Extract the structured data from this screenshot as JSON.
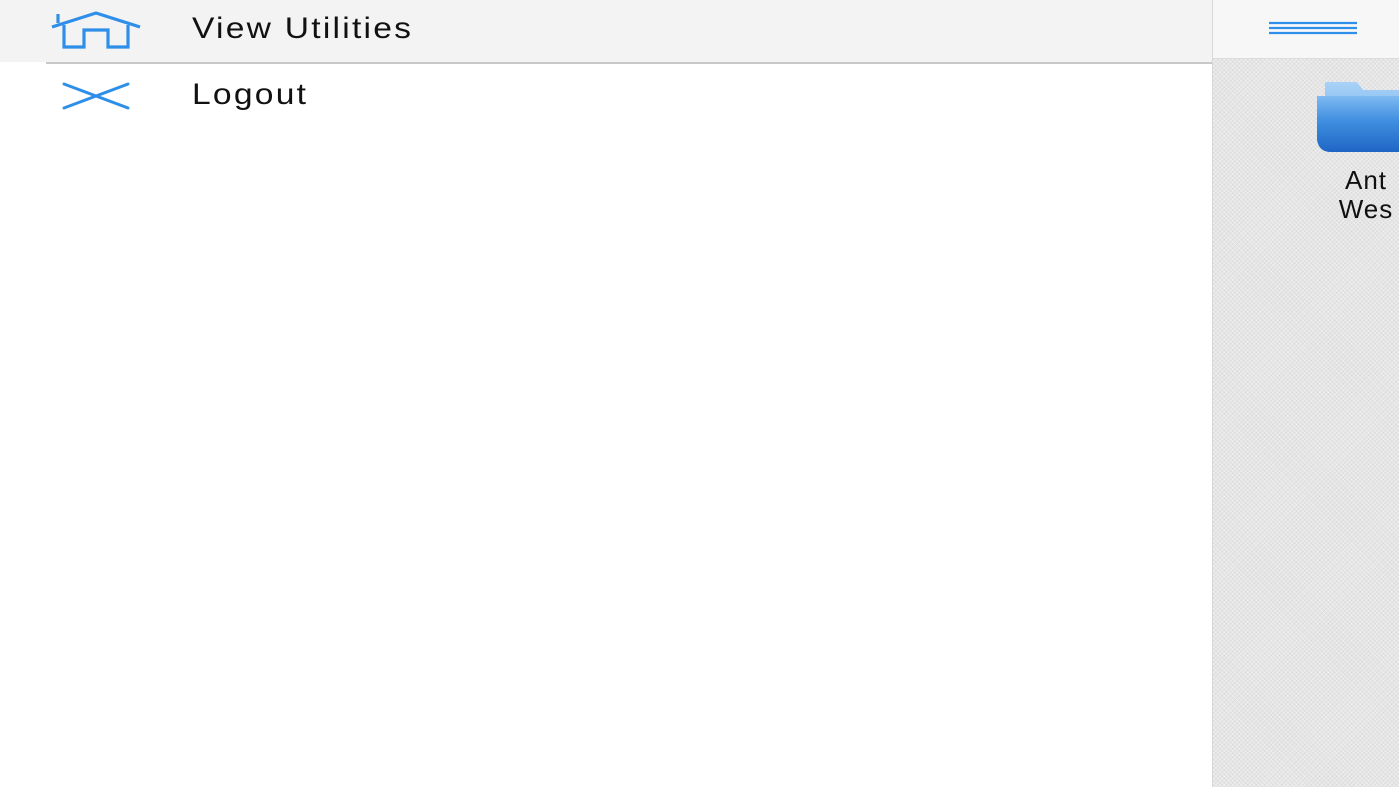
{
  "menu": {
    "items": [
      {
        "label": "View Utilities",
        "icon": "home-icon",
        "active": true
      },
      {
        "label": "Logout",
        "icon": "close-icon",
        "active": false
      }
    ]
  },
  "main": {
    "folder": {
      "line1": "Ant",
      "line2": "Wes",
      "icon": "folder-icon"
    }
  },
  "colors": {
    "accent": "#2f8fe8",
    "active_row": "#f3f3f3",
    "text": "#111111"
  }
}
